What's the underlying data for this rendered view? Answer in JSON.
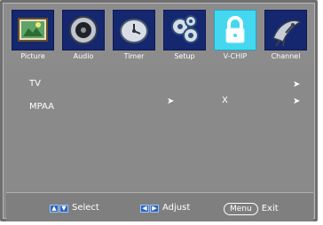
{
  "tabs": [
    {
      "label": "Picture",
      "icon": "picture-icon"
    },
    {
      "label": "Audio",
      "icon": "speaker-icon"
    },
    {
      "label": "Timer",
      "icon": "clock-icon"
    },
    {
      "label": "Setup",
      "icon": "gears-icon"
    },
    {
      "label": "V-CHIP",
      "icon": "lock-icon",
      "active": true
    },
    {
      "label": "Channel",
      "icon": "satellite-dish-icon"
    }
  ],
  "rows": [
    {
      "label": "TV"
    },
    {
      "label": "MPAA",
      "value": "X"
    }
  ],
  "footer": {
    "select_label": "Select",
    "adjust_label": "Adjust",
    "menu_label": "Menu",
    "exit_label": "Exit"
  },
  "colors": {
    "tab_bg": "#15276e",
    "tab_active_bg": "#46d7f0",
    "panel_bg": "#8a8a8a",
    "footer_bg": "#7f7f7f"
  }
}
